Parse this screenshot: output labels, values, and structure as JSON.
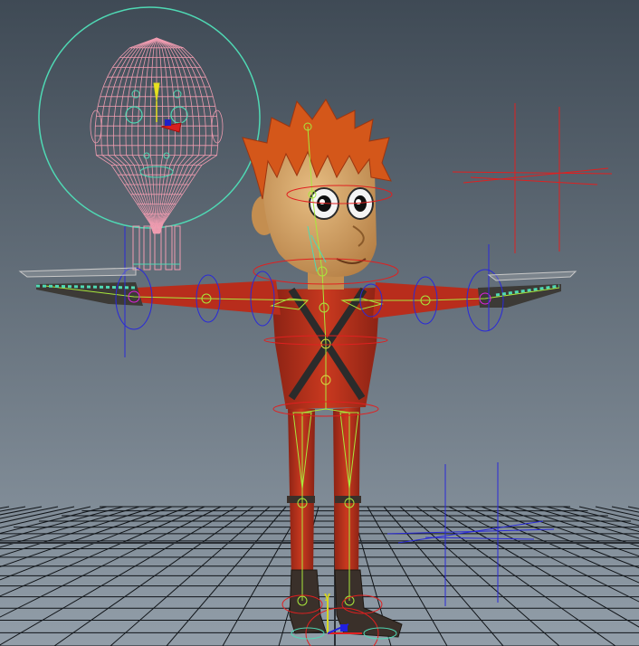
{
  "viewport": {
    "gradient_top": "#3f4a55",
    "gradient_bottom": "#929ea9",
    "grid_color": "#101418",
    "grid_highlight": "#2a2f35"
  },
  "colors": {
    "skin": "#d8a86a",
    "skin_shadow": "#b57f45",
    "hair": "#d4571a",
    "hair_dark": "#9c3510",
    "suit": "#c2331f",
    "suit_dark": "#8a2214",
    "boots": "#3a302a",
    "harness": "#2b2b2b",
    "joint_green": "#a8e83c",
    "joint_yellow": "#d8d840",
    "control_blue": "#2a2ad8",
    "control_red": "#e02020",
    "control_cyan": "#4fd9b4",
    "face_wire_pink": "#ef9cb0"
  },
  "gizmo_axes": {
    "y_label": "y",
    "y_color": "#d8d820",
    "x_color": "#e02020",
    "z_color": "#2020e0"
  }
}
